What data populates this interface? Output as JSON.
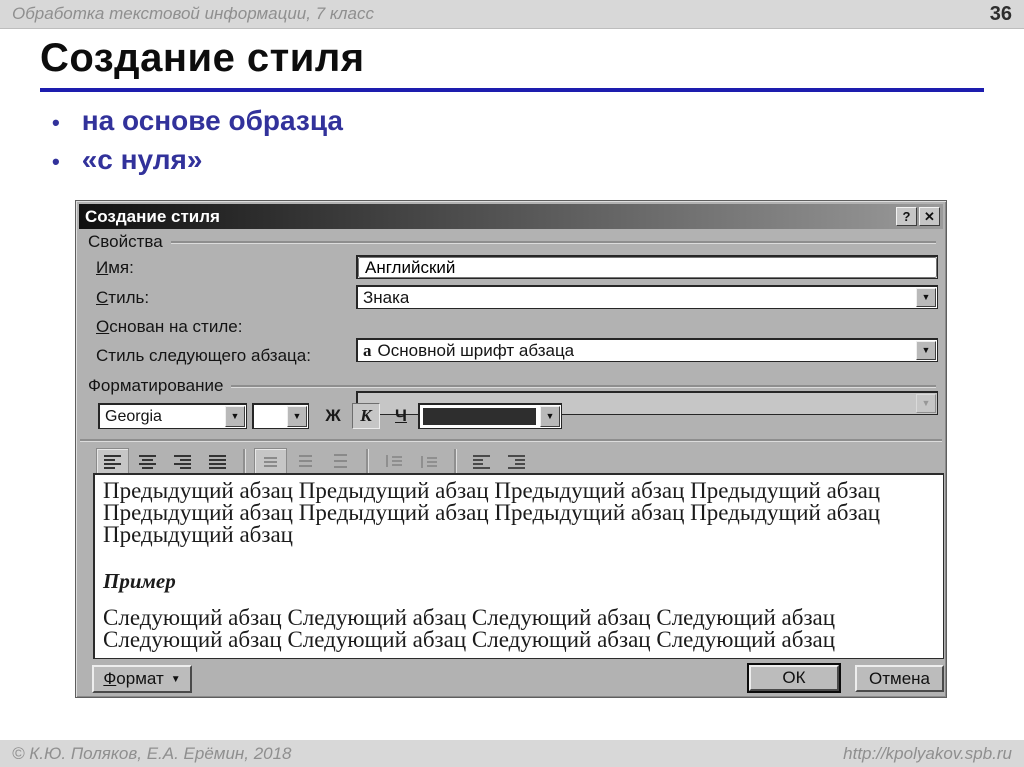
{
  "header": {
    "course_title": "Обработка текстовой информации, 7 класс",
    "page_number": "36"
  },
  "slide": {
    "title": "Создание стиля",
    "bullet_char": "•",
    "bullets": [
      "на основе образца",
      "«с нуля»"
    ]
  },
  "icons": {
    "dropdown_arrow": "▼",
    "menu_arrow": "▼"
  },
  "dialog": {
    "title": "Создание стиля",
    "titlebar": {
      "help_label": "?",
      "close_label": "✕"
    },
    "properties": {
      "group_label": "Свойства",
      "name_field": {
        "accel": "И",
        "rest": "мя:",
        "value": "Английский"
      },
      "style_field": {
        "accel": "С",
        "rest": "тиль:",
        "value": "Знака"
      },
      "based_on_field": {
        "accel": "О",
        "rest": "снован на стиле:",
        "prefix": "а",
        "value": "Основной шрифт абзаца"
      },
      "next_style_field": {
        "accel": "",
        "rest": "Стиль следующего абзаца:",
        "value": ""
      }
    },
    "formatting": {
      "group_label": "Форматирование",
      "font_family_value": "Georgia",
      "font_size_value": "",
      "bold_label": "Ж",
      "italic_label": "К",
      "underline_label": "Ч",
      "font_color": "#2e2e2e"
    },
    "preview": {
      "previous_lines": [
        "Предыдущий абзац Предыдущий абзац Предыдущий абзац Предыдущий абзац",
        "Предыдущий абзац Предыдущий абзац Предыдущий абзац Предыдущий абзац",
        "Предыдущий абзац"
      ],
      "sample_label": "Пример",
      "next_lines": [
        "Следующий абзац Следующий абзац Следующий абзац Следующий абзац",
        "Следующий абзац Следующий абзац Следующий абзац Следующий абзац"
      ]
    },
    "buttons": {
      "format": {
        "accel": "Ф",
        "rest": "ормат"
      },
      "ok_label": "ОК",
      "cancel_label": "Отмена"
    }
  },
  "footer": {
    "copyright": "© К.Ю. Поляков, Е.А. Ерёмин, 2018",
    "url": "http://kpolyakov.spb.ru"
  },
  "colors": {
    "accent_blue": "#1d1dae",
    "bullet_blue": "#32329b",
    "bar_gray": "#d8d8d8",
    "dialog_gray": "#b2b2b2"
  }
}
